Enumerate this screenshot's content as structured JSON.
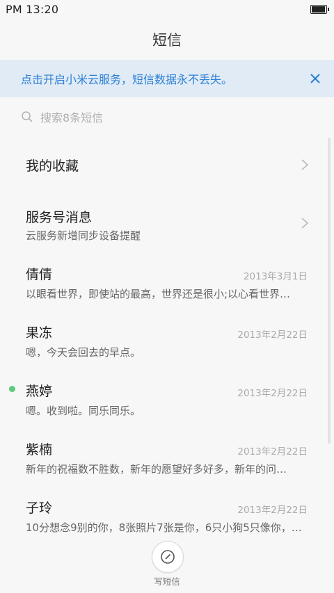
{
  "status_bar": {
    "time": "PM 13:20"
  },
  "header": {
    "title": "短信"
  },
  "banner": {
    "text": "点击开启小米云服务，短信数据永不丢失。"
  },
  "search": {
    "placeholder": "搜索8条短信"
  },
  "items": [
    {
      "title": "我的收藏"
    },
    {
      "title": "服务号消息",
      "subtitle": "云服务新增同步设备提醒"
    },
    {
      "name": "倩倩",
      "date": "2013年3月1日",
      "preview": "以眼看世界，即使站的最高，世界还是很小;以心看世界…"
    },
    {
      "name": "果冻",
      "date": "2013年2月22日",
      "preview": "嗯，今天会回去的早点。"
    },
    {
      "name": "燕婷",
      "date": "2013年2月22日",
      "preview": "嗯。收到啦。同乐同乐。",
      "unread": true
    },
    {
      "name": "紫楠",
      "date": "2013年2月22日",
      "preview": "新年的祝福数不胜数，新年的愿望好多好多，新年的问…"
    },
    {
      "name": "子玲",
      "date": "2013年2月22日",
      "preview": "10分想念9别的你，8张照片7张是你，6只小狗5只像你，…"
    }
  ],
  "compose": {
    "label": "写短信"
  },
  "colors": {
    "accent": "#2a7fd4",
    "banner_bg": "#e1ebf6",
    "unread_dot": "#5ccb7a",
    "background": "#f7f7f7"
  }
}
